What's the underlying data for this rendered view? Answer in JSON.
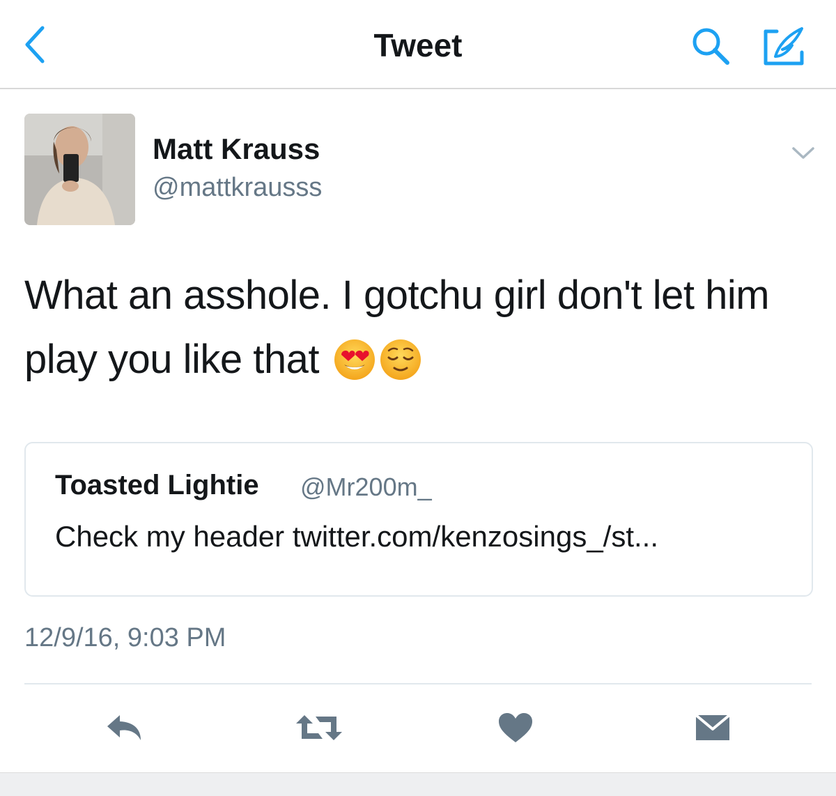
{
  "nav": {
    "title": "Tweet",
    "back_icon": "chevron-left-icon",
    "search_icon": "search-icon",
    "compose_icon": "compose-icon",
    "accent_color": "#1da1f2"
  },
  "tweet": {
    "author": {
      "display_name": "Matt Krauss",
      "username": "@mattkrausss",
      "avatar": "avatar-photo"
    },
    "text": "What an asshole. I gotchu girl don't let him play you like that",
    "emojis": [
      "heart-eyes-emoji",
      "relieved-face-emoji"
    ],
    "quoted": {
      "display_name": "Toasted Lightie",
      "username": "@Mr200m_",
      "text": "Check my header twitter.com/kenzosings_/st..."
    },
    "timestamp": "12/9/16, 9:03 PM"
  },
  "actions": {
    "reply_icon": "reply-icon",
    "retweet_icon": "retweet-icon",
    "like_icon": "heart-icon",
    "dm_icon": "envelope-icon",
    "icon_color": "#657786"
  }
}
